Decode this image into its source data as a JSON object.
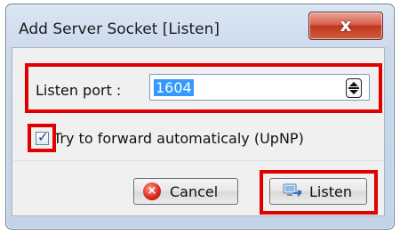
{
  "dialog": {
    "title": "Add Server Socket [Listen]",
    "close_icon": "close-icon"
  },
  "form": {
    "port_label": "Listen port :",
    "port_value": "1604",
    "upnp_label": "Try to forward automaticaly (UpNP)",
    "upnp_checked": true
  },
  "buttons": {
    "cancel_label": "Cancel",
    "cancel_icon": "cancel-circle-icon",
    "listen_label": "Listen",
    "listen_icon": "network-listen-icon"
  },
  "colors": {
    "highlight": "#e00000",
    "selection": "#3399ff"
  }
}
